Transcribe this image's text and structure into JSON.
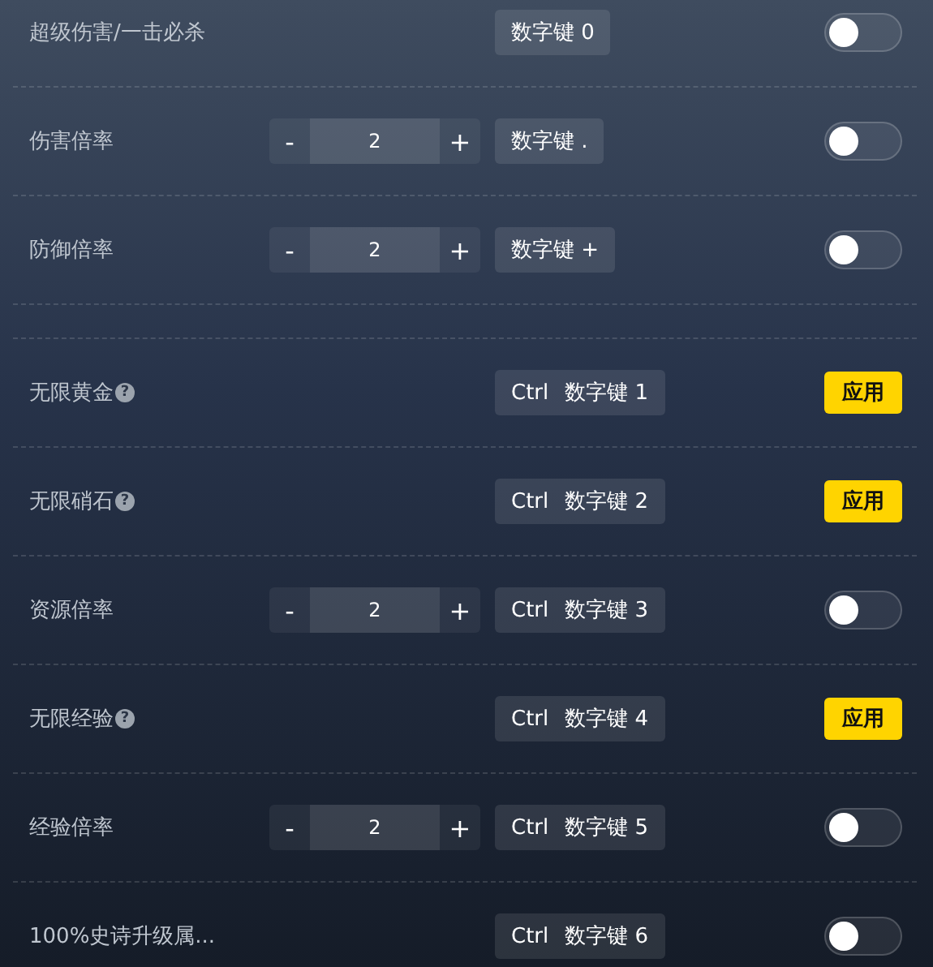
{
  "sections": [
    {
      "rows": [
        {
          "label": "超级伤害/一击必杀",
          "keys": [
            "数字键 0"
          ],
          "control": {
            "kind": "toggle",
            "on": false
          }
        },
        {
          "label": "伤害倍率",
          "stepper": {
            "decrement": "-",
            "value": "2",
            "increment": "+"
          },
          "keys": [
            "数字键 ."
          ],
          "control": {
            "kind": "toggle",
            "on": false
          }
        },
        {
          "label": "防御倍率",
          "stepper": {
            "decrement": "-",
            "value": "2",
            "increment": "+"
          },
          "keys": [
            "数字键 +"
          ],
          "control": {
            "kind": "toggle",
            "on": false
          }
        }
      ]
    },
    {
      "rows": [
        {
          "label": "无限黄金",
          "hint": "?",
          "keys": [
            "Ctrl",
            "数字键 1"
          ],
          "control": {
            "kind": "button",
            "label": "应用"
          }
        },
        {
          "label": "无限硝石",
          "hint": "?",
          "keys": [
            "Ctrl",
            "数字键 2"
          ],
          "control": {
            "kind": "button",
            "label": "应用"
          }
        },
        {
          "label": "资源倍率",
          "stepper": {
            "decrement": "-",
            "value": "2",
            "increment": "+"
          },
          "keys": [
            "Ctrl",
            "数字键 3"
          ],
          "control": {
            "kind": "toggle",
            "on": false
          }
        },
        {
          "label": "无限经验",
          "hint": "?",
          "keys": [
            "Ctrl",
            "数字键 4"
          ],
          "control": {
            "kind": "button",
            "label": "应用"
          }
        },
        {
          "label": "经验倍率",
          "stepper": {
            "decrement": "-",
            "value": "2",
            "increment": "+"
          },
          "keys": [
            "Ctrl",
            "数字键 5"
          ],
          "control": {
            "kind": "toggle",
            "on": false
          }
        },
        {
          "label": "100%史诗升级属...",
          "keys": [
            "Ctrl",
            "数字键 6"
          ],
          "control": {
            "kind": "toggle",
            "on": false
          }
        }
      ]
    }
  ]
}
